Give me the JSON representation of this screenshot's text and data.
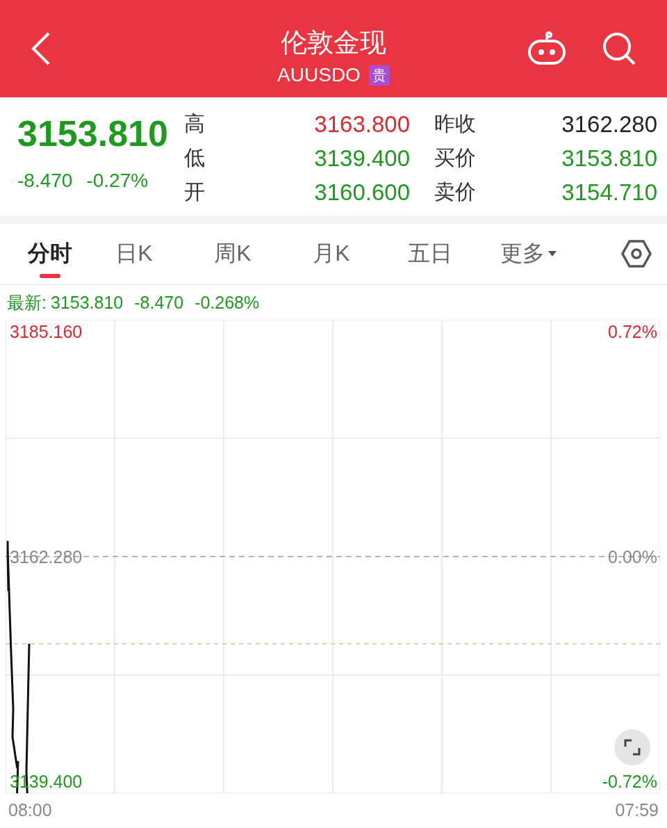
{
  "header": {
    "title": "伦敦金现",
    "code": "AUUSDO",
    "badge": "贵"
  },
  "quote": {
    "price": "3153.810",
    "change": "-8.470",
    "change_pct": "-0.27%"
  },
  "stats": [
    {
      "label": "高",
      "value": "3163.800",
      "color": "#e0262e"
    },
    {
      "label": "昨收",
      "value": "3162.280",
      "color": "#222222"
    },
    {
      "label": "低",
      "value": "3139.400",
      "color": "#1e9a1e"
    },
    {
      "label": "买价",
      "value": "3153.810",
      "color": "#1e9a1e"
    },
    {
      "label": "开",
      "value": "3160.600",
      "color": "#1e9a1e"
    },
    {
      "label": "卖价",
      "value": "3154.710",
      "color": "#1e9a1e"
    }
  ],
  "tabs": [
    {
      "label": "分时",
      "selected": true,
      "kind": "tab"
    },
    {
      "label": "日K",
      "selected": false,
      "kind": "tab"
    },
    {
      "label": "周K",
      "selected": false,
      "kind": "tab"
    },
    {
      "label": "月K",
      "selected": false,
      "kind": "tab"
    },
    {
      "label": "五日",
      "selected": false,
      "kind": "tab"
    },
    {
      "label": "更多",
      "selected": false,
      "kind": "menu"
    }
  ],
  "latest": {
    "label": "最新:",
    "price": "3153.810",
    "change": "-8.470",
    "change_pct": "-0.268%"
  },
  "chart": {
    "price_labels": [
      "3185.160",
      "3162.280",
      "3139.400"
    ],
    "percent_labels": [
      "0.72%",
      "0.00%",
      "-0.72%"
    ],
    "time_labels": [
      "08:00",
      "07:59"
    ]
  }
}
